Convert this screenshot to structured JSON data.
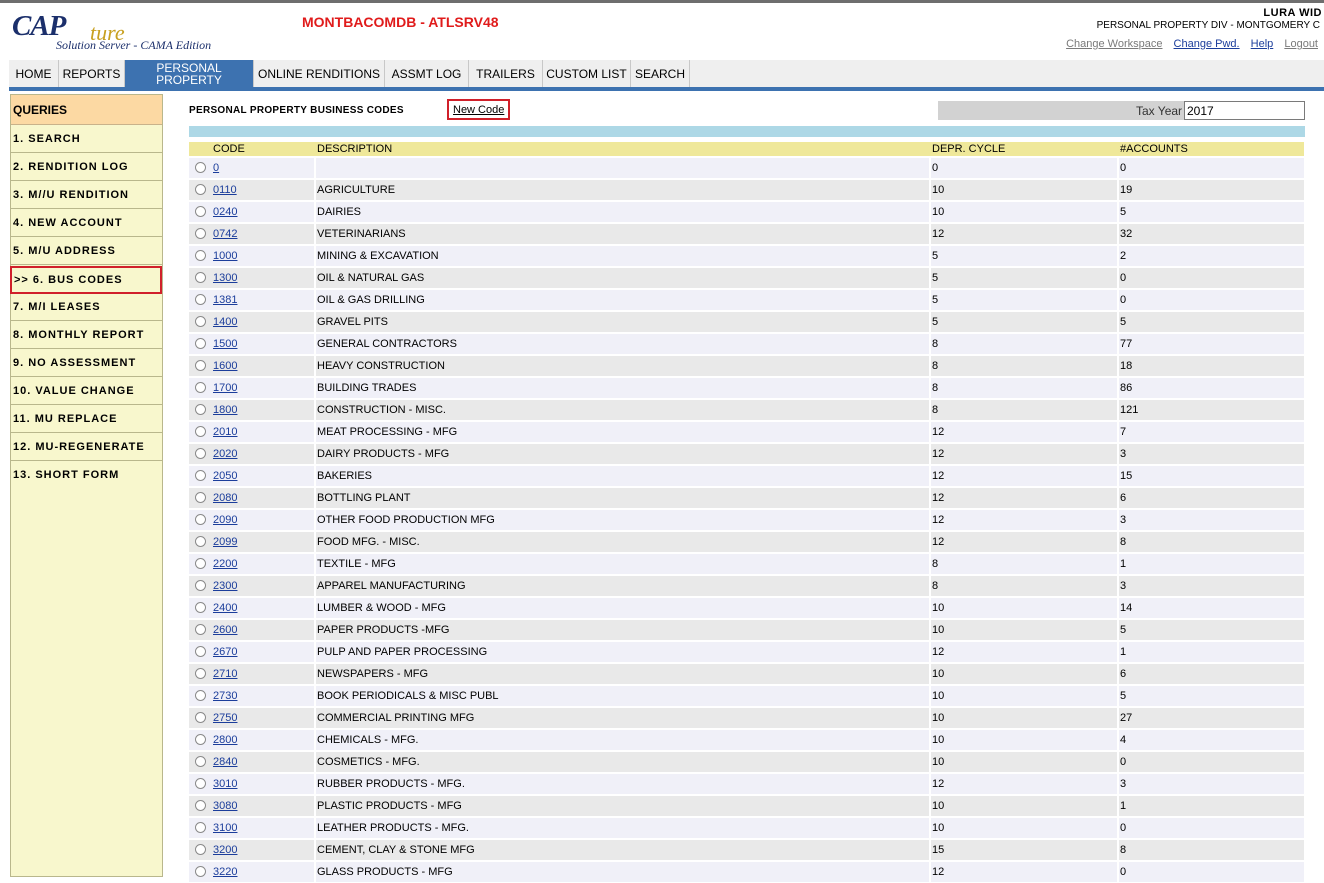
{
  "logo": {
    "main": "CAP",
    "script": "ture",
    "sub": "Solution Server - CAMA Edition"
  },
  "server": "MONTBACOMDB - ATLSRV48",
  "user": {
    "name": "LURA WID",
    "dept": "PERSONAL PROPERTY DIV  -  MONTGOMERY C",
    "links": {
      "change_workspace": "Change Workspace",
      "change_pwd": "Change Pwd.",
      "help": "Help",
      "logout": "Logout"
    }
  },
  "nav": {
    "home": "HOME",
    "reports": "REPORTS",
    "personal_line1": "PERSONAL",
    "personal_line2": "PROPERTY",
    "online_renditions": "ONLINE RENDITIONS",
    "assmt_log": "ASSMT LOG",
    "trailers": "TRAILERS",
    "custom_list": "CUSTOM LIST",
    "search": "SEARCH"
  },
  "sidebar": {
    "header": "QUERIES",
    "items": [
      "1. SEARCH",
      "2. RENDITION LOG",
      "3. M//U RENDITION",
      "4. NEW ACCOUNT",
      "5. M/U ADDRESS",
      ">> 6. BUS CODES",
      "7. M/I LEASES",
      "8. MONTHLY REPORT",
      "9. NO ASSESSMENT",
      "10. VALUE CHANGE",
      "11. MU REPLACE",
      "12. MU-REGENERATE",
      "13. SHORT FORM"
    ]
  },
  "main": {
    "title": "PERSONAL PROPERTY BUSINESS CODES",
    "new_code": "New Code",
    "tax_year_label": "Tax Year",
    "tax_year_value": "2017"
  },
  "table": {
    "headers": {
      "code": "CODE",
      "description": "DESCRIPTION",
      "depr_cycle": "DEPR. CYCLE",
      "accounts": "#ACCOUNTS"
    },
    "rows": [
      {
        "code": "0",
        "description": "",
        "depr_cycle": "0",
        "accounts": "0"
      },
      {
        "code": "0110",
        "description": "AGRICULTURE",
        "depr_cycle": "10",
        "accounts": "19"
      },
      {
        "code": "0240",
        "description": "DAIRIES",
        "depr_cycle": "10",
        "accounts": "5"
      },
      {
        "code": "0742",
        "description": "VETERINARIANS",
        "depr_cycle": "12",
        "accounts": "32"
      },
      {
        "code": "1000",
        "description": "MINING & EXCAVATION",
        "depr_cycle": "5",
        "accounts": "2"
      },
      {
        "code": "1300",
        "description": "OIL & NATURAL GAS",
        "depr_cycle": "5",
        "accounts": "0"
      },
      {
        "code": "1381",
        "description": "OIL & GAS DRILLING",
        "depr_cycle": "5",
        "accounts": "0"
      },
      {
        "code": "1400",
        "description": "GRAVEL PITS",
        "depr_cycle": "5",
        "accounts": "5"
      },
      {
        "code": "1500",
        "description": "GENERAL CONTRACTORS",
        "depr_cycle": "8",
        "accounts": "77"
      },
      {
        "code": "1600",
        "description": "HEAVY CONSTRUCTION",
        "depr_cycle": "8",
        "accounts": "18"
      },
      {
        "code": "1700",
        "description": "BUILDING TRADES",
        "depr_cycle": "8",
        "accounts": "86"
      },
      {
        "code": "1800",
        "description": "CONSTRUCTION - MISC.",
        "depr_cycle": "8",
        "accounts": "121"
      },
      {
        "code": "2010",
        "description": "MEAT PROCESSING - MFG",
        "depr_cycle": "12",
        "accounts": "7"
      },
      {
        "code": "2020",
        "description": "DAIRY PRODUCTS - MFG",
        "depr_cycle": "12",
        "accounts": "3"
      },
      {
        "code": "2050",
        "description": "BAKERIES",
        "depr_cycle": "12",
        "accounts": "15"
      },
      {
        "code": "2080",
        "description": "BOTTLING PLANT",
        "depr_cycle": "12",
        "accounts": "6"
      },
      {
        "code": "2090",
        "description": "OTHER FOOD PRODUCTION MFG",
        "depr_cycle": "12",
        "accounts": "3"
      },
      {
        "code": "2099",
        "description": "FOOD MFG. - MISC.",
        "depr_cycle": "12",
        "accounts": "8"
      },
      {
        "code": "2200",
        "description": "TEXTILE - MFG",
        "depr_cycle": "8",
        "accounts": "1"
      },
      {
        "code": "2300",
        "description": "APPAREL MANUFACTURING",
        "depr_cycle": "8",
        "accounts": "3"
      },
      {
        "code": "2400",
        "description": "LUMBER & WOOD - MFG",
        "depr_cycle": "10",
        "accounts": "14"
      },
      {
        "code": "2600",
        "description": "PAPER PRODUCTS -MFG",
        "depr_cycle": "10",
        "accounts": "5"
      },
      {
        "code": "2670",
        "description": "PULP AND PAPER PROCESSING",
        "depr_cycle": "12",
        "accounts": "1"
      },
      {
        "code": "2710",
        "description": "NEWSPAPERS - MFG",
        "depr_cycle": "10",
        "accounts": "6"
      },
      {
        "code": "2730",
        "description": "BOOK PERIODICALS & MISC PUBL",
        "depr_cycle": "10",
        "accounts": "5"
      },
      {
        "code": "2750",
        "description": "COMMERCIAL PRINTING MFG",
        "depr_cycle": "10",
        "accounts": "27"
      },
      {
        "code": "2800",
        "description": "CHEMICALS - MFG.",
        "depr_cycle": "10",
        "accounts": "4"
      },
      {
        "code": "2840",
        "description": "COSMETICS - MFG.",
        "depr_cycle": "10",
        "accounts": "0"
      },
      {
        "code": "3010",
        "description": "RUBBER PRODUCTS - MFG.",
        "depr_cycle": "12",
        "accounts": "3"
      },
      {
        "code": "3080",
        "description": "PLASTIC PRODUCTS - MFG",
        "depr_cycle": "10",
        "accounts": "1"
      },
      {
        "code": "3100",
        "description": "LEATHER PRODUCTS - MFG.",
        "depr_cycle": "10",
        "accounts": "0"
      },
      {
        "code": "3200",
        "description": "CEMENT, CLAY & STONE MFG",
        "depr_cycle": "15",
        "accounts": "8"
      },
      {
        "code": "3220",
        "description": "GLASS PRODUCTS - MFG",
        "depr_cycle": "12",
        "accounts": "0"
      }
    ]
  }
}
